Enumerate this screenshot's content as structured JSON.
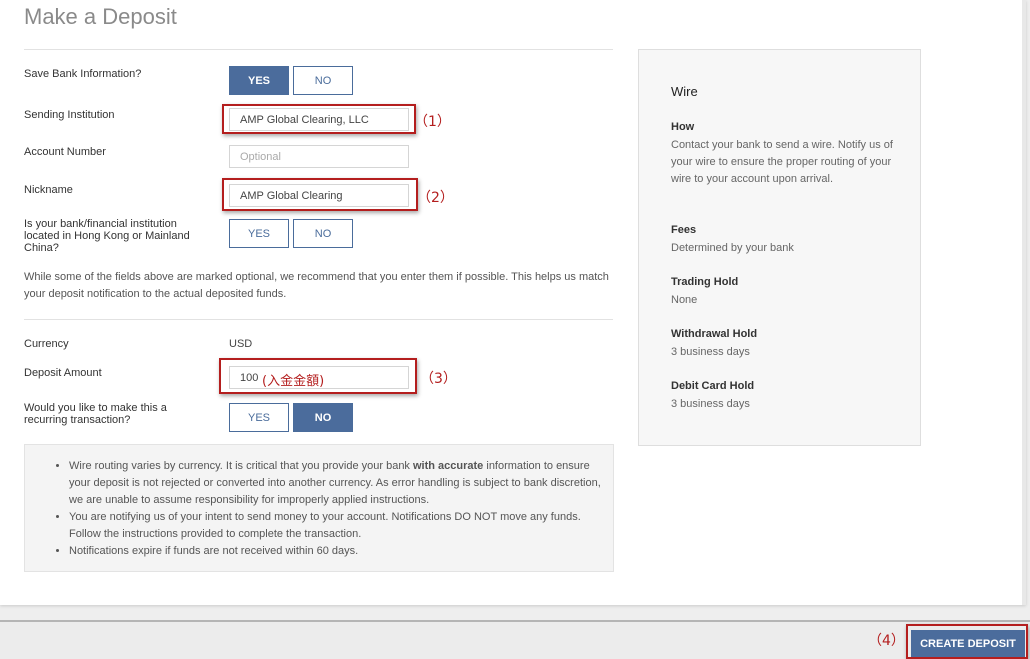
{
  "page": {
    "title": "Make a Deposit"
  },
  "form": {
    "save_bank_label": "Save Bank Information?",
    "yes_label": "YES",
    "no_label": "NO",
    "sending_institution_label": "Sending Institution",
    "sending_institution_value": "AMP Global Clearing, LLC",
    "account_number_label": "Account Number",
    "account_number_placeholder": "Optional",
    "nickname_label": "Nickname",
    "nickname_value": "AMP Global Clearing",
    "hk_china_label": "Is your bank/financial institution located in Hong Kong or Mainland China?",
    "note": "While some of the fields above are marked optional, we recommend that you enter them if possible. This helps us match your deposit notification to the actual deposited funds.",
    "currency_label": "Currency",
    "currency_value": "USD",
    "deposit_amount_label": "Deposit Amount",
    "deposit_amount_value": "100",
    "recurring_label": "Would you like to make this a recurring transaction?"
  },
  "annotations": {
    "a1": "（1）",
    "a2": "（2）",
    "a3": "（3）",
    "a4": "（4）",
    "deposit_amount_note": "(入金金額)"
  },
  "info": {
    "bullet1_a": "Wire routing varies by currency. It is critical that you provide your bank ",
    "bullet1_b": "with accurate",
    "bullet1_c": " information to ensure your deposit is not rejected or converted into another currency. As error handling is subject to bank discretion, we are unable to assume responsibility for improperly applied instructions.",
    "bullet2": "You are notifying us of your intent to send money to your account. Notifications DO NOT move any funds. Follow the instructions provided to complete the transaction.",
    "bullet3": "Notifications expire if funds are not received within 60 days."
  },
  "side": {
    "title": "Wire",
    "how_h": "How",
    "how_t": "Contact your bank to send a wire. Notify us of your wire to ensure the proper routing of your wire to your account upon arrival.",
    "fees_h": "Fees",
    "fees_t": "Determined by your bank",
    "trading_hold_h": "Trading Hold",
    "trading_hold_t": "None",
    "withdrawal_hold_h": "Withdrawal Hold",
    "withdrawal_hold_t": "3 business days",
    "debit_card_hold_h": "Debit Card Hold",
    "debit_card_hold_t": "3 business days"
  },
  "footer": {
    "create_deposit_label": "CREATE DEPOSIT"
  },
  "colors": {
    "accent": "#4b6c9c",
    "highlight": "#b41e1e"
  }
}
